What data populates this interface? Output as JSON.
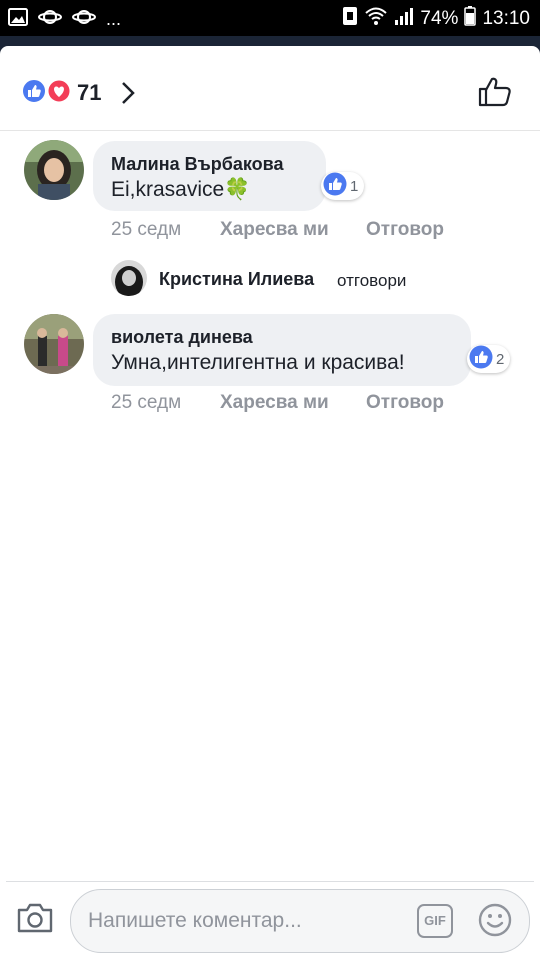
{
  "status_bar": {
    "left_icons": [
      "image-notification-icon",
      "planet-icon",
      "planet-icon"
    ],
    "more": "...",
    "battery": "74%",
    "time": "13:10"
  },
  "reactions": {
    "count": "71",
    "types": [
      "like",
      "love"
    ]
  },
  "comments": [
    {
      "author": "Малина Върбакова",
      "text": "Ei,krasavice🍀",
      "time": "25 седм",
      "like_label": "Харесва ми",
      "reply_label": "Отговор",
      "like_count": "1",
      "reply": {
        "author": "Кристина Илиева",
        "verb": "отговори"
      }
    },
    {
      "author": "виолета динева",
      "text": "Умна,интелигентна и красива!",
      "time": "25 седм",
      "like_label": "Харесва ми",
      "reply_label": "Отговор",
      "like_count": "2"
    }
  ],
  "composer": {
    "placeholder": "Напишете коментар...",
    "gif_label": "GIF"
  },
  "colors": {
    "like_blue": "#4b79f0",
    "love_red": "#f33e58",
    "bubble": "#eef0f3",
    "meta_gray": "#90949c"
  }
}
